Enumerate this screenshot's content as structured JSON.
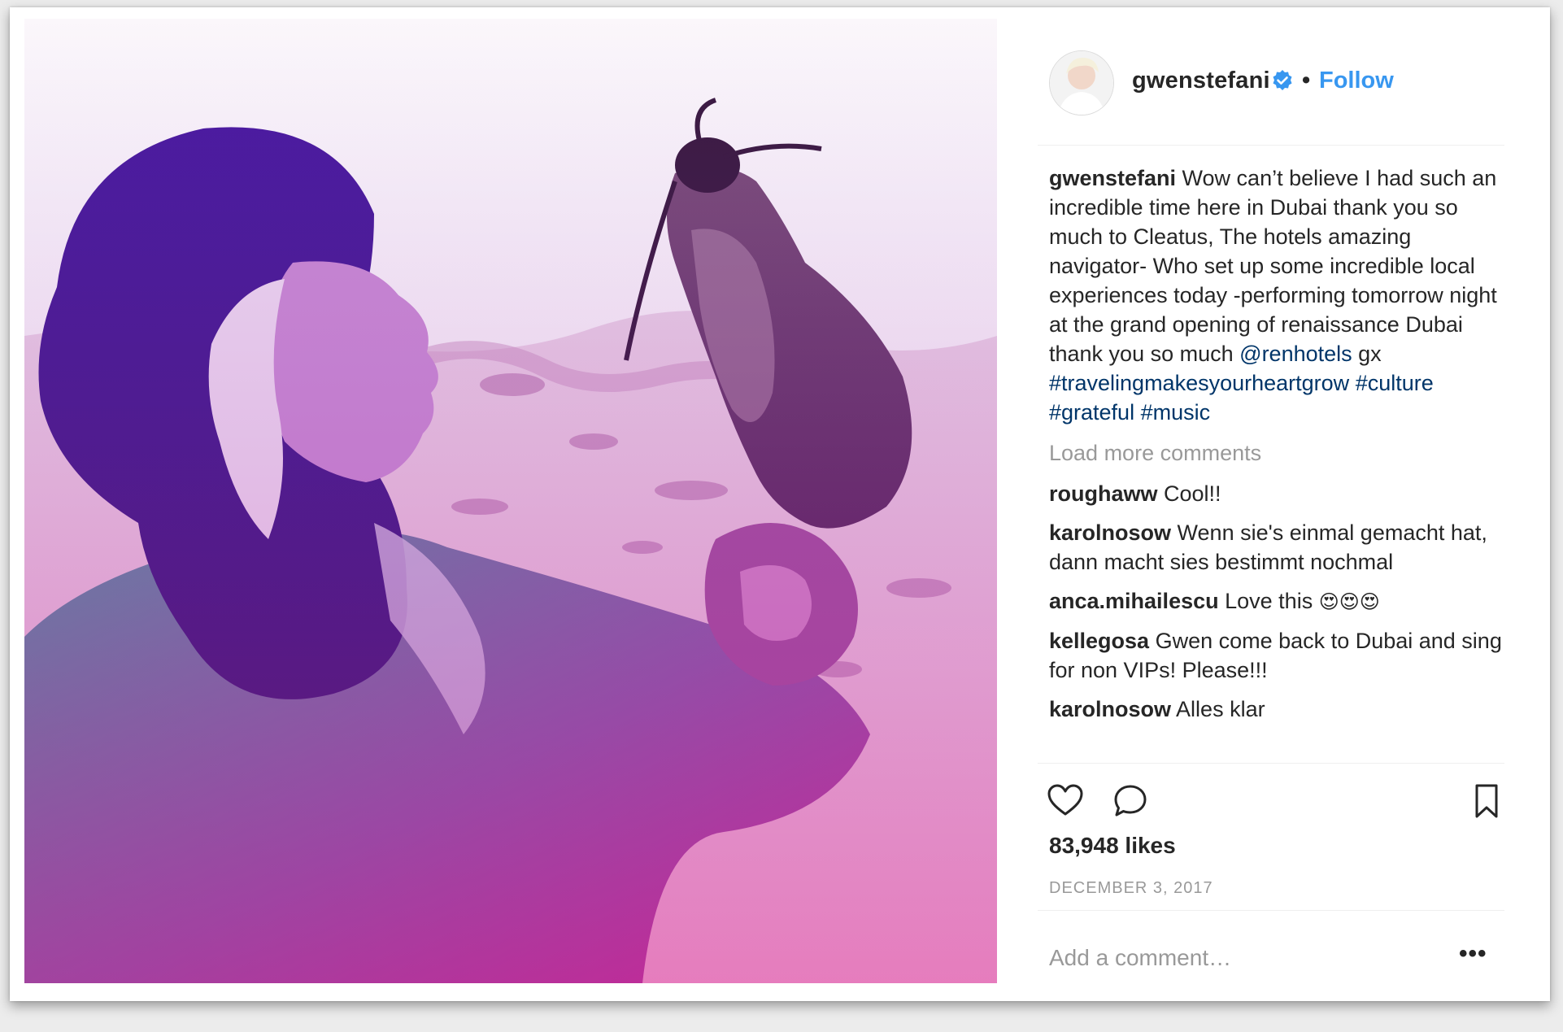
{
  "post": {
    "username": "gwenstefani",
    "follow_label": "Follow",
    "separator": "•",
    "caption": {
      "user": "gwenstefani",
      "text": "Wow can’t believe I had such an incredible time here in Dubai thank you so much to Cleatus, The hotels amazing navigator- Who set up some incredible local experiences today -performing tomorrow night at the grand opening of renaissance Dubai thank you so much",
      "mention": "@renhotels",
      "after_mention": "gx",
      "tags": [
        "#travelingmakesyourheartgrow",
        "#culture",
        "#grateful",
        "#music"
      ]
    },
    "load_more": "Load more comments",
    "comments": [
      {
        "user": "roughaww",
        "text": "Cool!!"
      },
      {
        "user": "karolnosow",
        "text": "Wenn sie's einmal gemacht hat, dann macht sies bestimmt nochmal"
      },
      {
        "user": "anca.mihailescu",
        "text": "Love this",
        "emoji": "😍😍😍"
      },
      {
        "user": "kellegosa",
        "text": "Gwen come back to Dubai and sing for non VIPs! Please!!!"
      },
      {
        "user": "karolnosow",
        "text": "Alles klar"
      }
    ],
    "likes": "83,948 likes",
    "date": "DECEMBER 3, 2017",
    "add_comment_placeholder": "Add a comment…",
    "more_label": "•••",
    "icons": [
      "heart-icon",
      "comment-icon",
      "bookmark-icon",
      "verified-icon"
    ],
    "colors": {
      "accent": "#3897f0",
      "link": "#003569",
      "muted": "#999999",
      "text": "#262626"
    }
  }
}
